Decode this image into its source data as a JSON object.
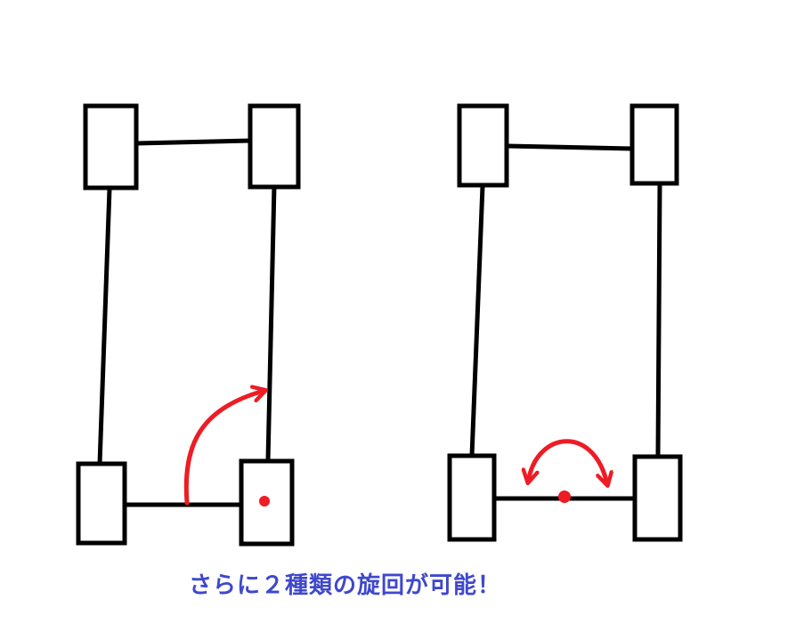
{
  "caption": {
    "text": "さらに２種類の旋回が可能！"
  },
  "colors": {
    "background": "#ffffff",
    "frame": "#000000",
    "annotation": "#ee1c24",
    "caption": "#3f48cc"
  },
  "diagrams": [
    {
      "name": "pivot-turn",
      "pivot": "rear-right-wheel",
      "arrow": "single-curved"
    },
    {
      "name": "spin-turn",
      "pivot": "rear-axle-center",
      "arrow": "double-curved"
    }
  ]
}
